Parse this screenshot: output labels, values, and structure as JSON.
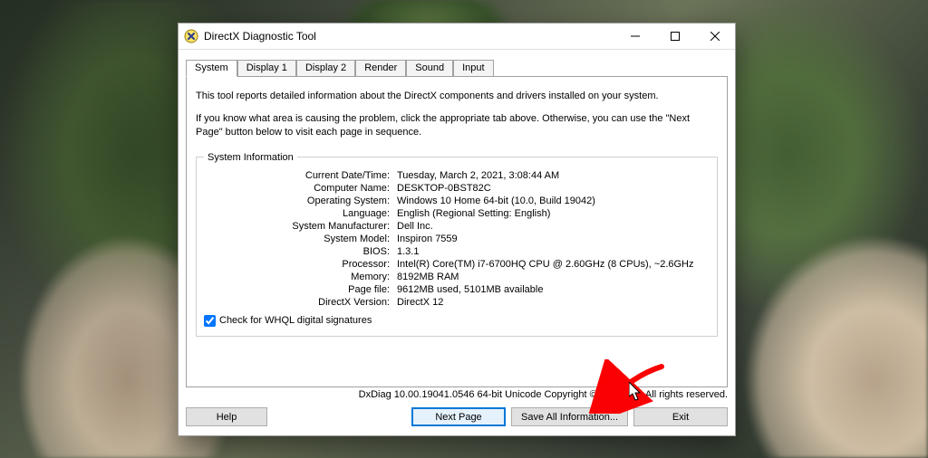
{
  "window": {
    "title": "DirectX Diagnostic Tool"
  },
  "tabs": {
    "system": "System",
    "display1": "Display 1",
    "display2": "Display 2",
    "render": "Render",
    "sound": "Sound",
    "input": "Input"
  },
  "intro": {
    "line1": "This tool reports detailed information about the DirectX components and drivers installed on your system.",
    "line2": "If you know what area is causing the problem, click the appropriate tab above.  Otherwise, you can use the \"Next Page\" button below to visit each page in sequence."
  },
  "group": {
    "legend": "System Information"
  },
  "labels": {
    "datetime": "Current Date/Time:",
    "computer": "Computer Name:",
    "os": "Operating System:",
    "language": "Language:",
    "manu": "System Manufacturer:",
    "model": "System Model:",
    "bios": "BIOS:",
    "processor": "Processor:",
    "memory": "Memory:",
    "pagefile": "Page file:",
    "dxver": "DirectX Version:"
  },
  "info": {
    "datetime": "Tuesday, March 2, 2021, 3:08:44 AM",
    "computer": "DESKTOP-0BST82C",
    "os": "Windows 10 Home 64-bit (10.0, Build 19042)",
    "language": "English (Regional Setting: English)",
    "manu": "Dell Inc.",
    "model": "Inspiron 7559",
    "bios": "1.3.1",
    "processor": "Intel(R) Core(TM) i7-6700HQ CPU @ 2.60GHz (8 CPUs), ~2.6GHz",
    "memory": "8192MB RAM",
    "pagefile": "9612MB used, 5101MB available",
    "dxver": "DirectX 12"
  },
  "whql": {
    "checked": true,
    "label": "Check for WHQL digital signatures"
  },
  "version_line": "DxDiag 10.00.19041.0546 64-bit Unicode   Copyright © Microsoft. All rights reserved.",
  "buttons": {
    "help": "Help",
    "next": "Next Page",
    "save": "Save All Information...",
    "exit": "Exit"
  }
}
